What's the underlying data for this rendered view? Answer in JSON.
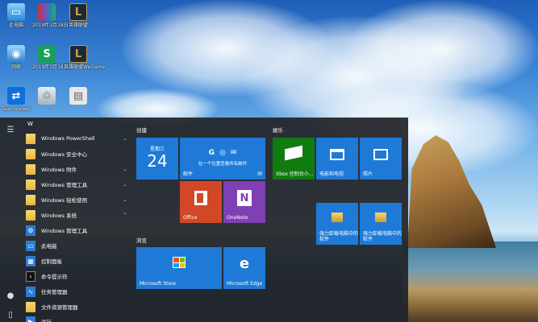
{
  "desktop": {
    "icons": [
      {
        "label": "此电脑",
        "icon": "computer-icon"
      },
      {
        "label": "2019年3月18日",
        "icon": "winrar-icon"
      },
      {
        "label": "英雄联盟",
        "icon": "lol-icon"
      },
      {
        "label": "网络",
        "icon": "network-icon"
      },
      {
        "label": "2019年3月18日",
        "icon": "wps-icon"
      },
      {
        "label": "英雄联盟WeGame",
        "icon": "lol-wegame-icon"
      },
      {
        "label": "TeamViewer",
        "icon": "teamviewer-icon"
      },
      {
        "label": "",
        "icon": "recycle-icon"
      },
      {
        "label": "",
        "icon": "document-icon"
      }
    ]
  },
  "start_menu": {
    "letter": "W",
    "apps": [
      {
        "label": "Windows PowerShell",
        "type": "folder",
        "chevron": "⌄"
      },
      {
        "label": "Windows 安全中心",
        "type": "shield",
        "chevron": ""
      },
      {
        "label": "Windows 附件",
        "type": "folder",
        "chevron": "⌄"
      },
      {
        "label": "Windows 管理工具",
        "type": "folder",
        "chevron": "⌄"
      },
      {
        "label": "Windows 轻松使用",
        "type": "folder",
        "chevron": "⌄"
      },
      {
        "label": "Windows 系统",
        "type": "folder",
        "chevron": "⌃"
      },
      {
        "label": "Windows 管理工具",
        "type": "blue",
        "chevron": ""
      },
      {
        "label": "此电脑",
        "type": "blue",
        "chevron": ""
      },
      {
        "label": "控制面板",
        "type": "blue",
        "chevron": ""
      },
      {
        "label": "命令提示符",
        "type": "blue",
        "chevron": ""
      },
      {
        "label": "任务管理器",
        "type": "blue",
        "chevron": ""
      },
      {
        "label": "文件资源管理器",
        "type": "blue",
        "chevron": ""
      },
      {
        "label": "运行",
        "type": "blue",
        "chevron": ""
      }
    ],
    "groups": {
      "create": "创建",
      "entertainment": "娱乐",
      "browse": "浏览"
    },
    "tiles": {
      "calendar_day": "星期三",
      "calendar_date": "24",
      "mail_text": "在一个位置查看所有邮件",
      "mail_label": "邮件",
      "office": "Office",
      "onenote": "OneNote",
      "xbox": "Xbox 控制台小...",
      "movies": "电影和电视",
      "photos": "照片",
      "app1": "强力卸载电脑中的软件",
      "app2": "强力卸载电脑中的软件",
      "store": "Microsoft Store",
      "edge": "Microsoft Edge"
    }
  },
  "colors": {
    "tile_blue": "#1e7ad6",
    "office_orange": "#d24726",
    "onenote_purple": "#7f3fb5",
    "xbox_green": "#107c10"
  }
}
